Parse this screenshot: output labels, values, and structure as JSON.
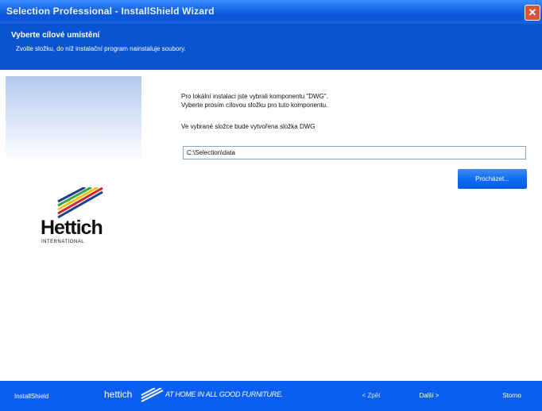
{
  "window": {
    "title": "Selection Professional - InstallShield Wizard"
  },
  "header": {
    "title": "Vyberte cílové umístění",
    "subtitle": "Zvolte složku, do níž instalační program nainstaluje soubory."
  },
  "logo": {
    "name": "Hettich",
    "tagline": "INTERNATIONAL"
  },
  "content": {
    "info_line1": "Pro lokální instalaci jste vybrali komponentu \"DWG\".",
    "info_line2": "Vyberte prosím cílovou složku pro tuto komponentu.",
    "folder_note": "Ve vybrané složce bude vytvořena složka DWG",
    "path_value": "C:\\Selection\\data",
    "browse_label": "Procházet..."
  },
  "footer": {
    "installshield": "InstallShield",
    "brand": "hettich",
    "slogan": "AT HOME IN ALL GOOD FURNITURE.",
    "back_label": "< Zpět",
    "next_label": "Další >",
    "cancel_label": "Storno"
  },
  "colors": {
    "titlebar": "#0a54d8",
    "header": "#0b54cf",
    "footer": "#0b5ff0",
    "button": "#0d6bf2",
    "close": "#d9533a"
  },
  "icons": {
    "close": "close-icon",
    "logo_mark": "hettich-stripes-icon",
    "brand_mark": "hettich-stripes-icon"
  }
}
